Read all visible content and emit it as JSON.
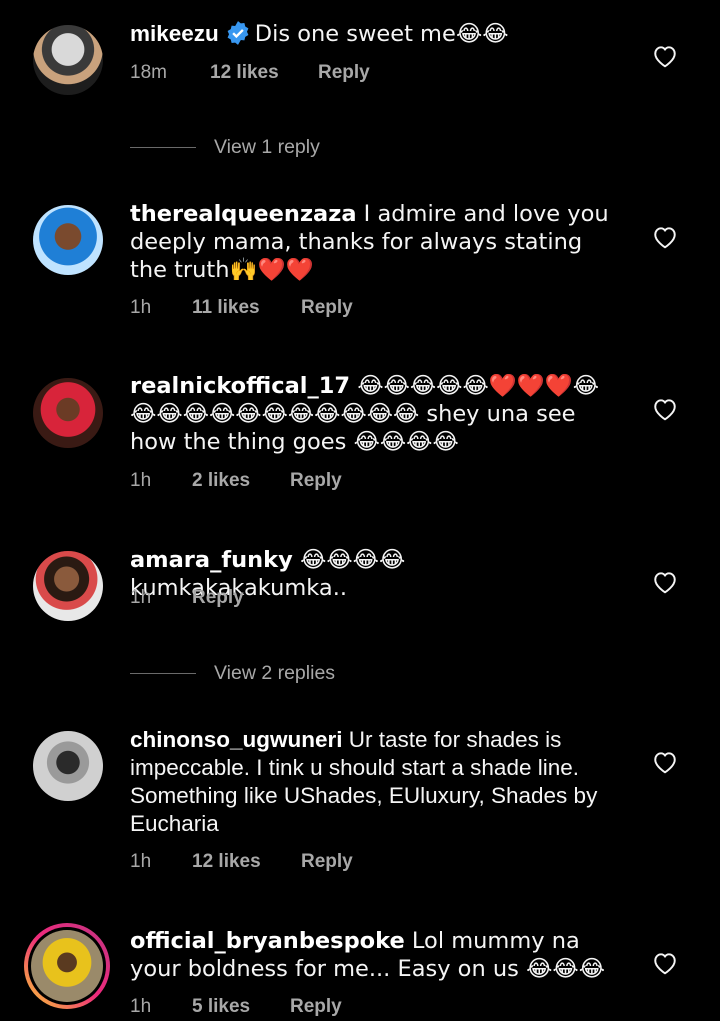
{
  "comments": [
    {
      "username": "mikeezu",
      "verified": true,
      "text": "Dis one sweet me😂😂",
      "time": "18m",
      "likes": "12 likes",
      "reply": "Reply"
    },
    {
      "username": "therealqueenzaza",
      "text": "I admire and love you deeply mama, thanks for always stating the truth🙌❤️❤️",
      "time": "1h",
      "likes": "11 likes",
      "reply": "Reply"
    },
    {
      "username": "realnickoffical_17",
      "text": "😂😂😂😂😂❤️❤️❤️😂😂😂😂😂😂😂😂😂😂😂😂 shey una see how the thing goes 😂😂😂😂",
      "time": "1h",
      "likes": "2 likes",
      "reply": "Reply"
    },
    {
      "username": "amara_funky",
      "text": "😂😂😂😂 kumkakakakumka..",
      "time": "1h",
      "reply": "Reply"
    },
    {
      "username": "chinonso_ugwuneri",
      "text": "Ur taste for shades is impeccable. I tink u should start a shade line. Something like UShades, EUluxury, Shades by Eucharia",
      "time": "1h",
      "likes": "12 likes",
      "reply": "Reply"
    },
    {
      "username": "official_bryanbespoke",
      "text": "Lol mummy na your boldness for me... Easy on us 😂😂😂",
      "time": "1h",
      "likes": "5 likes",
      "reply": "Reply"
    }
  ],
  "view_replies": [
    "View 1 reply",
    "View 2 replies"
  ],
  "icons": {
    "heart": "heart-outline-icon",
    "verified": "verified-badge-icon"
  },
  "colors": {
    "background": "#000000",
    "secondary_text": "#a8a8a8",
    "verified_blue": "#3897f0"
  }
}
